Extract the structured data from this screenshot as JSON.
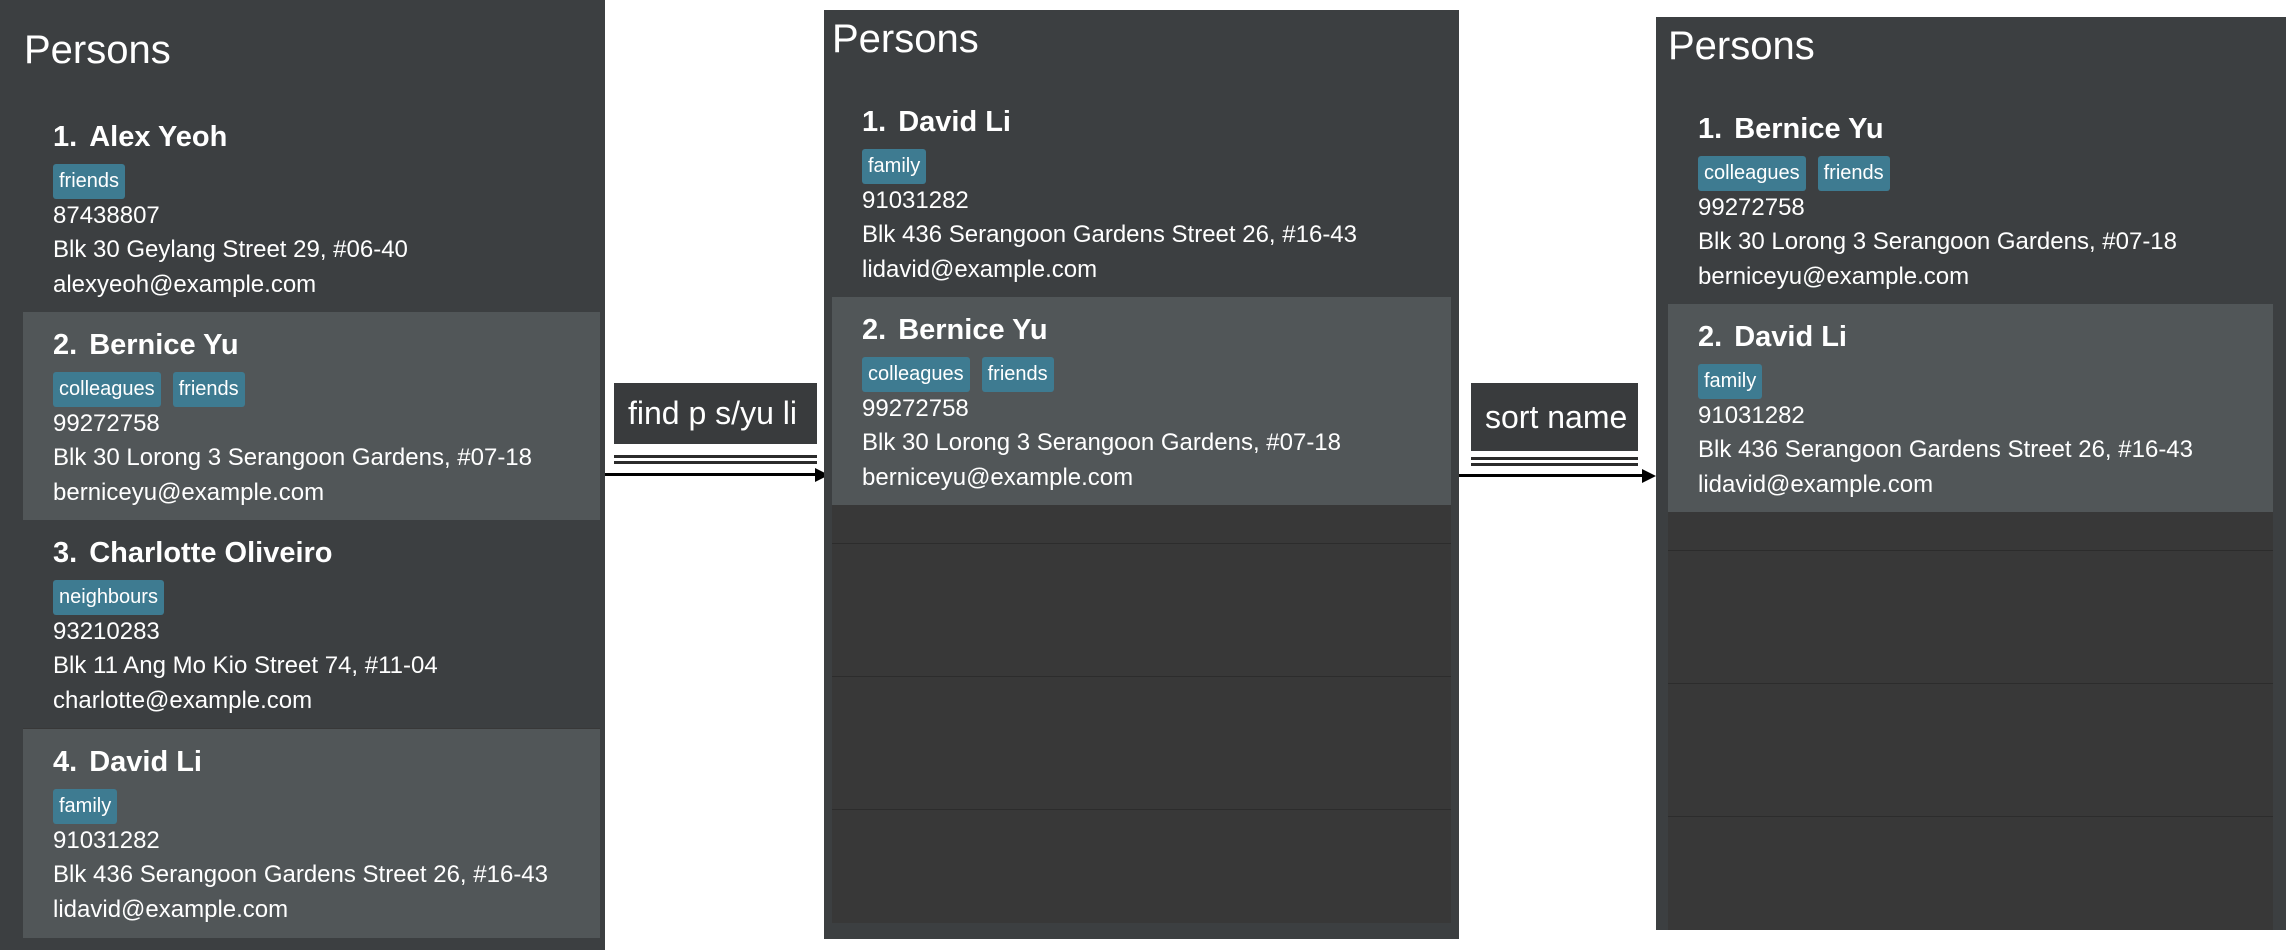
{
  "panels": [
    {
      "title": "Persons",
      "persons": [
        {
          "index": "1.",
          "name": "Alex Yeoh",
          "tags": [
            "friends"
          ],
          "phone": "87438807",
          "address": "Blk 30 Geylang Street 29, #06-40",
          "email": "alexyeoh@example.com"
        },
        {
          "index": "2.",
          "name": "Bernice Yu",
          "tags": [
            "colleagues",
            "friends"
          ],
          "phone": "99272758",
          "address": "Blk 30 Lorong 3 Serangoon Gardens, #07-18",
          "email": "berniceyu@example.com"
        },
        {
          "index": "3.",
          "name": "Charlotte Oliveiro",
          "tags": [
            "neighbours"
          ],
          "phone": "93210283",
          "address": "Blk 11 Ang Mo Kio Street 74, #11-04",
          "email": "charlotte@example.com"
        },
        {
          "index": "4.",
          "name": "David Li",
          "tags": [
            "family"
          ],
          "phone": "91031282",
          "address": "Blk 436 Serangoon Gardens Street 26, #16-43",
          "email": "lidavid@example.com"
        }
      ]
    },
    {
      "title": "Persons",
      "persons": [
        {
          "index": "1.",
          "name": "David Li",
          "tags": [
            "family"
          ],
          "phone": "91031282",
          "address": "Blk 436 Serangoon Gardens Street 26, #16-43",
          "email": "lidavid@example.com"
        },
        {
          "index": "2.",
          "name": "Bernice Yu",
          "tags": [
            "colleagues",
            "friends"
          ],
          "phone": "99272758",
          "address": "Blk 30 Lorong 3 Serangoon Gardens, #07-18",
          "email": "berniceyu@example.com"
        }
      ]
    },
    {
      "title": "Persons",
      "persons": [
        {
          "index": "1.",
          "name": "Bernice Yu",
          "tags": [
            "colleagues",
            "friends"
          ],
          "phone": "99272758",
          "address": "Blk 30 Lorong 3 Serangoon Gardens, #07-18",
          "email": "berniceyu@example.com"
        },
        {
          "index": "2.",
          "name": "David Li",
          "tags": [
            "family"
          ],
          "phone": "91031282",
          "address": "Blk 436 Serangoon Gardens Street 26, #16-43",
          "email": "lidavid@example.com"
        }
      ]
    }
  ],
  "commands": [
    {
      "text": "find p s/yu li"
    },
    {
      "text": "sort name"
    }
  ],
  "colors": {
    "panel_bg": "#3c3f41",
    "card_alt_bg": "#515658",
    "tag_bg": "#3e7b91",
    "text": "#ffffff"
  }
}
